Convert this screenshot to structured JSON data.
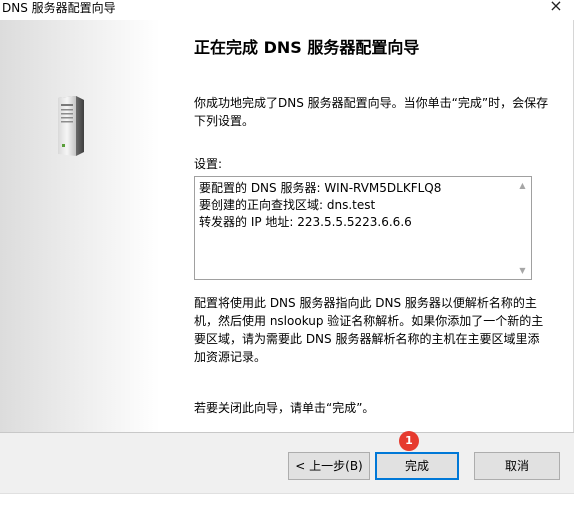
{
  "window": {
    "title": "DNS 服务器配置向导",
    "close_glyph": "×"
  },
  "content": {
    "heading": "正在完成 DNS 服务器配置向导",
    "intro": "你成功地完成了DNS 服务器配置向导。当你单击“完成”时，会保存下列设置。",
    "settings_label": "设置:",
    "settings_lines": [
      "要配置的 DNS 服务器: WIN-RVM5DLKFLQ8",
      "要创建的正向查找区域: dns.test",
      "转发器的 IP 地址: 223.5.5.5223.6.6.6"
    ],
    "description": "配置将使用此 DNS 服务器指向此 DNS 服务器以便解析名称的主机，然后使用 nslookup 验证名称解析。如果你添加了一个新的主要区域，请为需要此 DNS 服务器解析名称的主机在主要区域里添加资源记录。",
    "close_hint": "若要关闭此向导，请单击“完成”。"
  },
  "buttons": {
    "back": "< 上一步(B)",
    "finish": "完成",
    "cancel": "取消"
  },
  "annotation": {
    "badge": "1",
    "badge_color": "#e63a2e"
  },
  "colors": {
    "focus_border": "#0078d7"
  }
}
